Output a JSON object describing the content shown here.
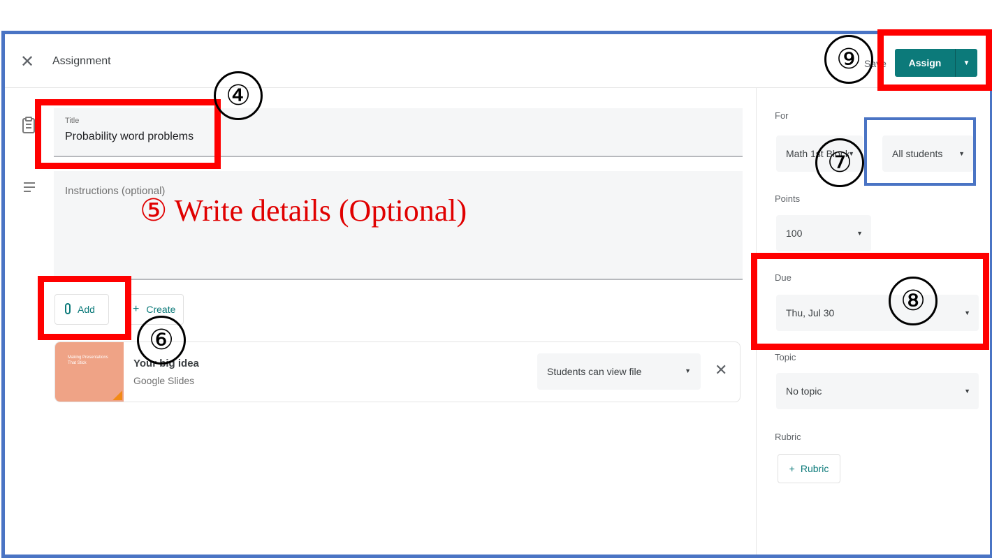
{
  "header": {
    "title": "Assignment",
    "save_label": "Save",
    "assign_label": "Assign"
  },
  "form": {
    "title_caption": "Title",
    "title_value": "Probability word problems",
    "instructions_placeholder": "Instructions (optional)",
    "add_label": "Add",
    "create_label": "Create"
  },
  "attachment": {
    "name": "Your big idea",
    "type": "Google Slides",
    "thumb_text": "Making Presentations That Stick",
    "permission": "Students can view file"
  },
  "settings": {
    "for_label": "For",
    "class_value": "Math 1st Block",
    "students_value": "All students",
    "points_label": "Points",
    "points_value": "100",
    "due_label": "Due",
    "due_value": "Thu, Jul 30",
    "topic_label": "Topic",
    "topic_value": "No topic",
    "rubric_label": "Rubric",
    "rubric_button": "Rubric"
  },
  "annotations": {
    "n4": "④",
    "n6": "⑥",
    "n7": "⑦",
    "n8": "⑧",
    "n9": "⑨",
    "details_text": "⑤ Write details (Optional)"
  },
  "colors": {
    "accent": "#0c7a7a",
    "highlight_red": "#ff0000",
    "highlight_blue": "#4a74c4",
    "annotation_text": "#e00000"
  },
  "icons": [
    "close-icon",
    "clipboard-icon",
    "notes-icon",
    "paperclip-icon",
    "plus-icon",
    "chevron-down-icon"
  ]
}
